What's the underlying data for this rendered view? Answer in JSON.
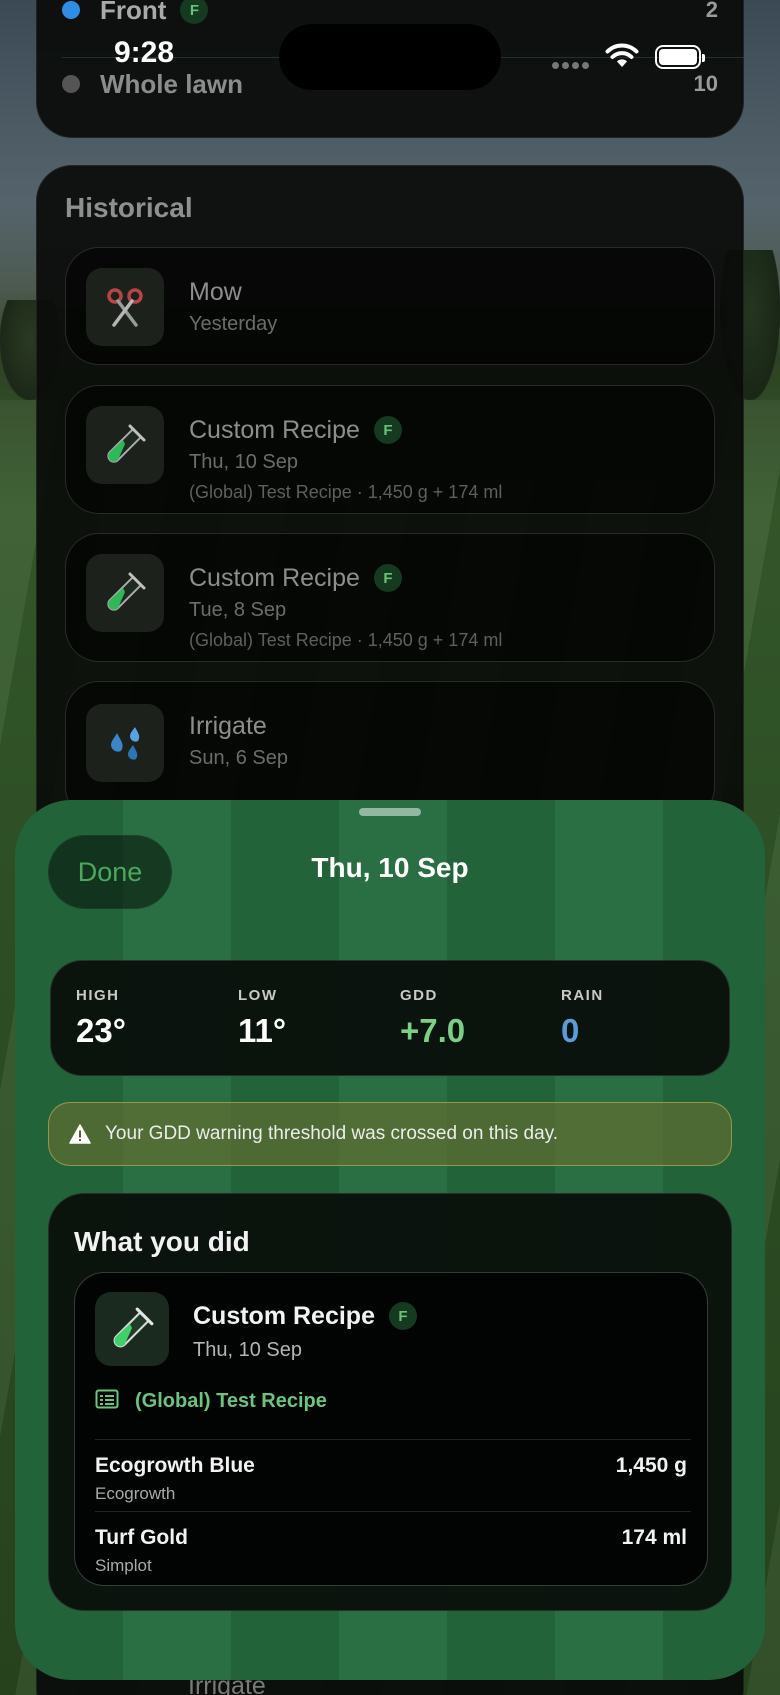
{
  "status_bar": {
    "time": "9:28"
  },
  "locations": [
    {
      "name": "Front",
      "badge": "F",
      "count": "2",
      "color": "#2f8de4"
    },
    {
      "name": "Whole lawn",
      "count": "10",
      "color": "#555555"
    }
  ],
  "historical": {
    "title": "Historical",
    "items": [
      {
        "name": "Mow",
        "date": "Yesterday",
        "icon": "scissors-icon"
      },
      {
        "name": "Custom Recipe",
        "badge": "F",
        "date": "Thu, 10 Sep",
        "detail": "(Global) Test Recipe · 1,450 g + 174 ml",
        "icon": "test-tube-icon"
      },
      {
        "name": "Custom Recipe",
        "badge": "F",
        "date": "Tue, 8 Sep",
        "detail": "(Global) Test Recipe · 1,450 g + 174 ml",
        "icon": "test-tube-icon"
      },
      {
        "name": "Irrigate",
        "date": "Sun, 6 Sep",
        "icon": "water-drops-icon"
      },
      {
        "name": "Irrigate"
      }
    ]
  },
  "sheet": {
    "done_label": "Done",
    "title": "Thu, 10 Sep",
    "weather": [
      {
        "label": "HIGH",
        "value": "23°"
      },
      {
        "label": "LOW",
        "value": "11°"
      },
      {
        "label": "GDD",
        "value": "+7.0"
      },
      {
        "label": "RAIN",
        "value": "0"
      }
    ],
    "warning": "Your GDD warning threshold was crossed on this day.",
    "what_you_did": {
      "title": "What you did",
      "entry": {
        "name": "Custom Recipe",
        "badge": "F",
        "date": "Thu, 10 Sep",
        "recipe": "(Global) Test Recipe",
        "products": [
          {
            "name": "Ecogrowth Blue",
            "brand": "Ecogrowth",
            "quantity": "1,450 g"
          },
          {
            "name": "Turf Gold",
            "brand": "Simplot",
            "quantity": "174 ml"
          }
        ]
      }
    }
  },
  "colors": {
    "accent_green": "#6cc47d",
    "rain_blue": "#5b9bd8",
    "sheet_green": "#22633a"
  }
}
